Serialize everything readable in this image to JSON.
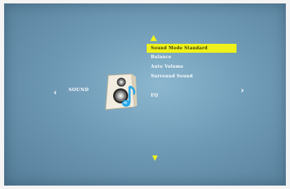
{
  "osd": {
    "category_label": "SOUND",
    "nav_left_glyph": "‹",
    "nav_right_glyph": "›",
    "category_icon": "speaker-icon",
    "highlight_color": "#eef21a",
    "menu_items": [
      {
        "label": "Sound Mode Standard",
        "state": "selected"
      },
      {
        "label": "Balance",
        "state": "normal"
      },
      {
        "label": "Auto Volume",
        "state": "normal"
      },
      {
        "label": "Surround Sound",
        "state": "normal"
      },
      {
        "label": "",
        "state": "disabled"
      },
      {
        "label": "EQ",
        "state": "normal"
      }
    ]
  }
}
